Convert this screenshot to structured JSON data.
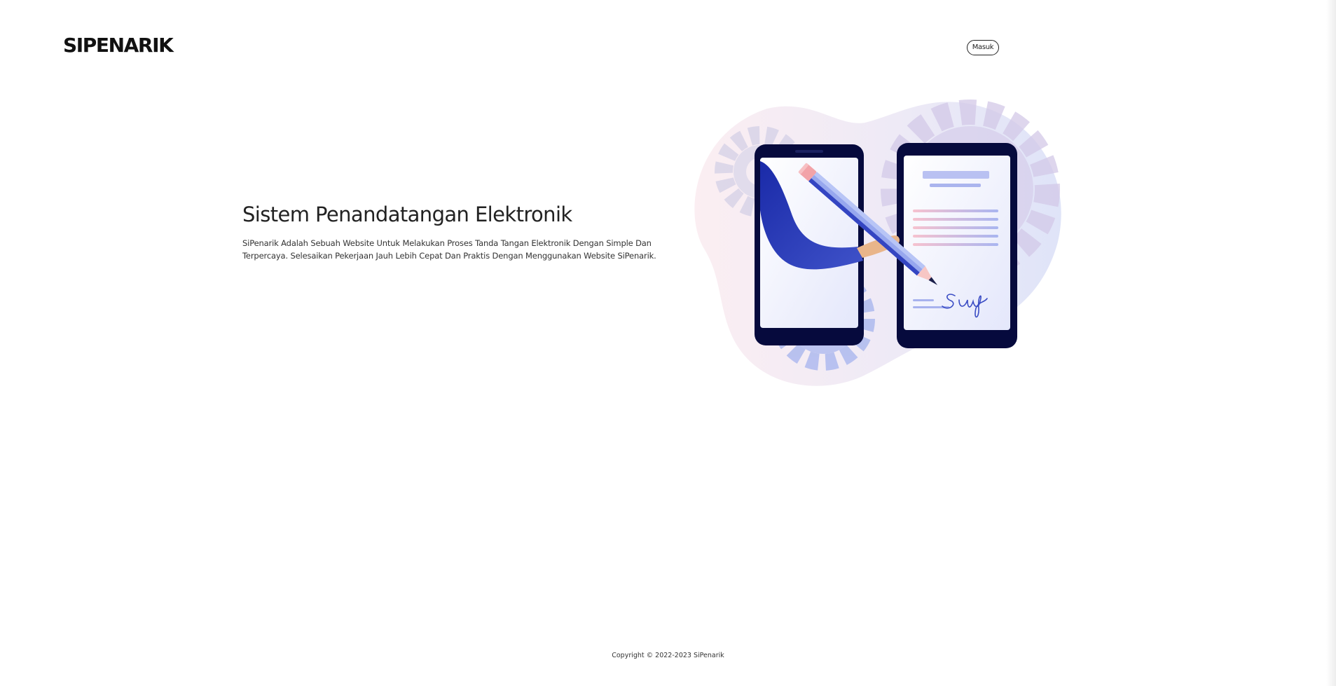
{
  "header": {
    "brand": "SIPENARIK",
    "login_label": "Masuk"
  },
  "hero": {
    "title": "Sistem Penandatangan Elektronik",
    "description": "SiPenarik Adalah Sebuah Website Untuk Melakukan Proses Tanda Tangan Elektronik Dengan Simple Dan Terpercaya. Selesaikan Pekerjaan Jauh Lebih Cepat Dan Praktis Dengan Menggunakan Website SiPenarik."
  },
  "illustration": {
    "name": "electronic-signature-illustration",
    "colors": {
      "navy": "#060a3d",
      "blue": "#2c3cb0",
      "light_blue": "#9eaef0",
      "pink": "#f3c9d3",
      "skin": "#e9b58a"
    }
  },
  "footer": {
    "copyright": "Copyright © 2022-2023 SiPenarik"
  }
}
